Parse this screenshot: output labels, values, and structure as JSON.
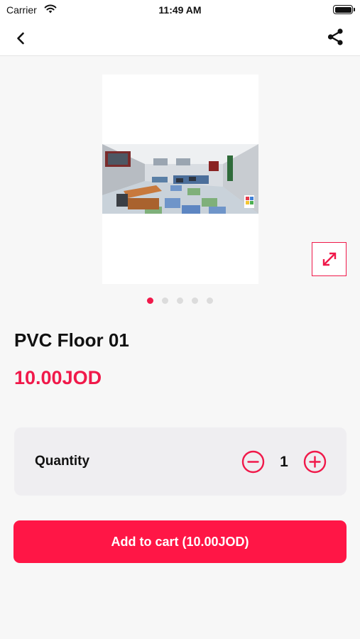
{
  "status_bar": {
    "carrier": "Carrier",
    "time": "11:49 AM",
    "wifi_icon": "wifi-icon",
    "battery_icon": "battery-icon"
  },
  "nav": {
    "back_icon": "chevron-left-icon",
    "share_icon": "share-icon"
  },
  "gallery": {
    "image_count": 5,
    "active_index": 0,
    "expand_icon": "expand-icon"
  },
  "product": {
    "title": "PVC Floor 01",
    "price": "10.00JOD"
  },
  "quantity": {
    "label": "Quantity",
    "value": "1",
    "minus_icon": "minus-circle-icon",
    "plus_icon": "plus-circle-icon"
  },
  "cart": {
    "button_label": "Add to cart (10.00JOD)"
  },
  "colors": {
    "accent": "#f0194a",
    "button": "#ff1646",
    "background": "#f7f7f7",
    "card": "#efeef1"
  }
}
